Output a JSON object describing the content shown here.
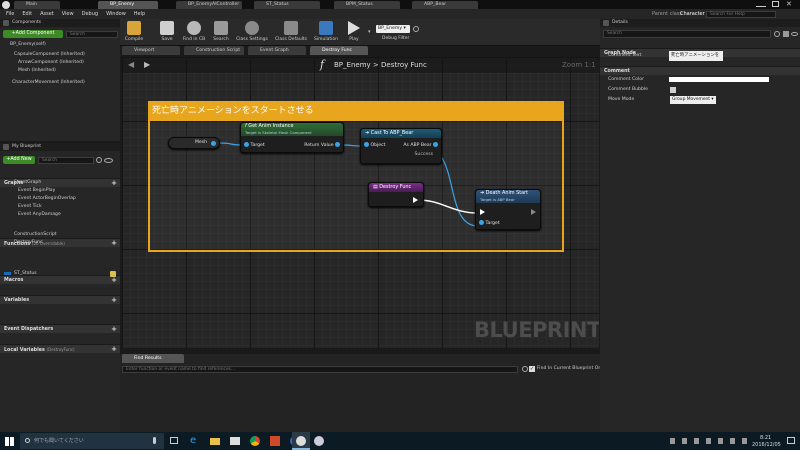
{
  "window_tabs": [
    "Main",
    "BP_Enemy",
    "BP_EnemyAIController",
    "ST_Status",
    "BPM_Status",
    "ABP_Bear"
  ],
  "menu": [
    "File",
    "Edit",
    "Asset",
    "View",
    "Debug",
    "Window",
    "Help"
  ],
  "parent_class": {
    "label": "Parent class:",
    "value": "Character"
  },
  "help_search": {
    "placeholder": "Search For Help"
  },
  "toolbar": {
    "items": [
      "Compile",
      "Save",
      "Find in CB",
      "Search",
      "Class Settings",
      "Class Defaults",
      "Simulation",
      "Play"
    ],
    "debug_filter": {
      "value": "BP_Enemy",
      "label": "Debug Filter"
    }
  },
  "components": {
    "title": "Components",
    "add_button": "+Add Component",
    "search_placeholder": "Search",
    "items": [
      "BP_Enemy(self)",
      "CapsuleComponent (Inherited)",
      "ArrowComponent (Inherited)",
      "Mesh (Inherited)",
      "CharacterMovement (Inherited)"
    ]
  },
  "my_blueprint": {
    "title": "My Blueprint",
    "add_button": "+Add New",
    "search_placeholder": "Search",
    "graphs": {
      "label": "Graphs",
      "event_graph": "EventGraph",
      "events": [
        "Event BeginPlay",
        "Event ActorBeginOverlap",
        "Event Tick",
        "Event AnyDamage"
      ]
    },
    "functions": {
      "label": "Functions",
      "note": "(26 Overridable)",
      "items": [
        "ConstructionScript",
        "DestroyFunc"
      ]
    },
    "macros": "Macros",
    "variables": {
      "label": "Variables",
      "items": [
        "ST_Status"
      ]
    },
    "event_dispatchers": "Event Dispatchers",
    "local_variables": {
      "label": "Local Variables",
      "note": "(DestroyFunc)"
    }
  },
  "editor_tabs": [
    "Viewport",
    "Construction Script",
    "Event Graph",
    "Destroy Func"
  ],
  "graph": {
    "breadcrumb_root": "BP_Enemy",
    "breadcrumb_sep": ">",
    "breadcrumb_leaf": "Destroy Func",
    "zoom": "Zoom 1:1",
    "watermark": "BLUEPRINT",
    "comment": "死亡時アニメーションをスタートさせる",
    "mesh_node": "Mesh",
    "get_anim": {
      "title": "Get Anim Instance",
      "subtitle": "Target is Skeletal Mesh Component",
      "target": "Target",
      "return": "Return Value"
    },
    "cast": {
      "title": "Cast To ABP_Bear",
      "object": "Object",
      "as": "As ABP Bear",
      "success": "Success"
    },
    "destroy": {
      "title": "Destroy Func"
    },
    "death": {
      "title": "Death Anim Start",
      "subtitle": "Target is ABP Bear",
      "target": "Target"
    }
  },
  "find_results": {
    "title": "Find Results",
    "placeholder": "Enter function or event name to find references...",
    "checkbox": "Find In Current Blueprint Only"
  },
  "details": {
    "title": "Details",
    "search_placeholder": "Search",
    "graph_node": "Graph Node",
    "comment_text_label": "Comment Text",
    "comment_text_value": "死亡時アニメーションを",
    "comment_section": "Comment",
    "comment_color": "Comment Color",
    "comment_bubble": "Comment Bubble",
    "move_mode": "Move Mode",
    "move_mode_value": "Group Movement"
  },
  "taskbar": {
    "search": "何でも聞いてください",
    "time": "8:21",
    "date": "2016/12/05"
  },
  "colors": {
    "accent": "#e8a61e",
    "pure_func": "#2f6d36",
    "cast": "#1f4f6a",
    "function": "#6d2d7a",
    "event": "#2c4a6b",
    "green_button": "#3d8a26"
  }
}
